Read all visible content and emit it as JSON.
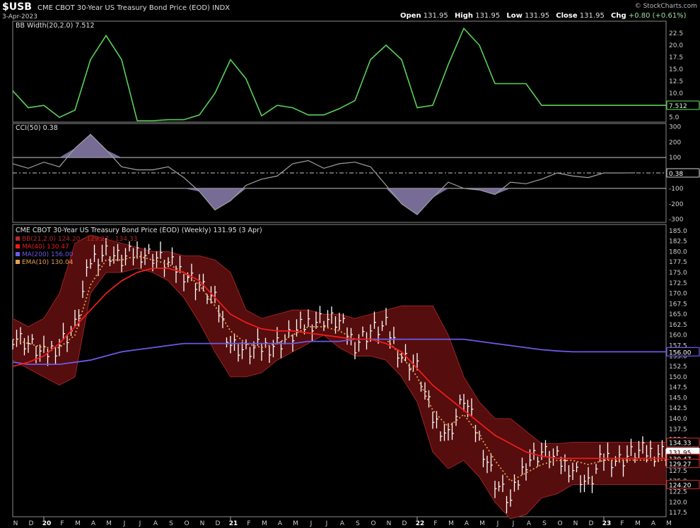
{
  "header": {
    "symbol": "$USB",
    "name": "CME CBOT 30-Year US Treasury Bond Price (EOD)",
    "exchange": "INDX",
    "date": "3-Apr-2023",
    "open_label": "Open",
    "open": "131.95",
    "high_label": "High",
    "high": "131.95",
    "low_label": "Low",
    "low": "131.95",
    "close_label": "Close",
    "close": "131.95",
    "chg_label": "Chg",
    "chg": "+0.80 (+0.61%)",
    "source": "© StockCharts.com"
  },
  "colors": {
    "background": "#000000",
    "bbwidth_line": "#58d058",
    "cci_line": "#a0a0a0",
    "cci_fill": "#8c7fb0",
    "price_bars": "#ffffff",
    "bb_fill": "#5a0e0e",
    "bb_lines": "#b82828",
    "ma40": "#ee1c1c",
    "ma200": "#6a5ae8",
    "ema10": "#e8a050"
  },
  "chart_data": [
    {
      "type": "line",
      "panel": "indicator",
      "title": "BB Width(20,2.0) 7.512",
      "ylim": [
        4,
        25
      ],
      "yticks": [
        5.0,
        7.5,
        10.0,
        12.5,
        15.0,
        17.5,
        20.0,
        22.5
      ],
      "ytick_labels": [
        "5.0",
        "7.5",
        "10.0",
        "12.5",
        "15.0",
        "17.5",
        "20.0",
        "22.5"
      ],
      "last_value_label": "7.512",
      "x_points": [
        0,
        4,
        8,
        12,
        16,
        20,
        24,
        28,
        32,
        36,
        40,
        44,
        48,
        52,
        56,
        60,
        64,
        68,
        72,
        76,
        80,
        84,
        88,
        92,
        96,
        100,
        104,
        108,
        112,
        116,
        120,
        124,
        128,
        132,
        136,
        140,
        144,
        148,
        152,
        156,
        160,
        164,
        168
      ],
      "values": [
        10.5,
        7.0,
        7.5,
        5.0,
        6.5,
        17,
        22,
        17,
        4.3,
        4.3,
        4.5,
        4.5,
        5.5,
        10,
        17,
        13,
        5.3,
        7.5,
        7,
        5.5,
        5.5,
        6.8,
        8.5,
        17,
        20,
        17,
        7,
        7.5,
        16,
        23.5,
        20,
        12,
        12,
        12,
        7.5,
        7.5,
        7.5,
        7.5,
        7.5,
        7.5,
        7.5,
        7.5,
        7.5
      ]
    },
    {
      "type": "area",
      "panel": "indicator",
      "title": "CCI(50) 0.38",
      "ylim": [
        -320,
        320
      ],
      "yticks": [
        -300,
        -200,
        -100,
        100,
        200,
        300
      ],
      "ytick_labels": [
        "300",
        "200",
        "100",
        "-100",
        "-200",
        "-300"
      ],
      "reference_lines": [
        100,
        0,
        -100
      ],
      "last_value_label": "0.38",
      "x_points": [
        0,
        4,
        8,
        12,
        16,
        20,
        24,
        28,
        32,
        36,
        40,
        44,
        48,
        52,
        56,
        60,
        64,
        68,
        72,
        76,
        80,
        84,
        88,
        92,
        96,
        100,
        104,
        108,
        112,
        116,
        120,
        124,
        128,
        132,
        136,
        140,
        144,
        148,
        152,
        156,
        160
      ],
      "values": [
        60,
        30,
        70,
        40,
        160,
        250,
        150,
        40,
        20,
        20,
        40,
        -30,
        -120,
        -240,
        -180,
        -80,
        -40,
        -20,
        60,
        80,
        30,
        60,
        70,
        40,
        -80,
        -200,
        -270,
        -160,
        -60,
        -100,
        -110,
        -140,
        -60,
        -70,
        -40,
        0,
        -20,
        -30,
        0,
        0,
        0.38
      ]
    },
    {
      "type": "line",
      "panel": "price",
      "title": "CME CBOT 30-Year US Treasury Bond Price (EOD) (Weekly) 131.95 (3 Apr)",
      "legend": [
        {
          "name": "BB(21,2.0) 124.20 - 129.27 - 134.33",
          "swatch": "bb"
        },
        {
          "name": "MA(40) 130.47",
          "swatch": "ma40"
        },
        {
          "name": "MA(200) 156.00",
          "swatch": "ma200"
        },
        {
          "name": "EMA(10) 130.04",
          "swatch": "ema10"
        }
      ],
      "legend_position": "top-left",
      "ylim": [
        116.5,
        186.5
      ],
      "yticks": [
        117.5,
        120,
        122.5,
        125,
        127.5,
        130,
        132.5,
        135,
        137.5,
        140,
        142.5,
        145,
        147.5,
        150,
        152.5,
        155,
        157.5,
        160,
        162.5,
        165,
        167.5,
        170,
        172.5,
        175,
        177.5,
        180,
        182.5,
        185
      ],
      "ytick_labels": [
        "117.5",
        "120.0",
        "122.5",
        "125.0",
        "127.5",
        "130.0",
        "132.5",
        "135.0",
        "137.5",
        "140.0",
        "142.5",
        "145.0",
        "147.5",
        "150.0",
        "152.5",
        "155.0",
        "157.5",
        "160.0",
        "162.5",
        "165.0",
        "167.5",
        "170.0",
        "172.5",
        "175.0",
        "177.5",
        "180.0",
        "182.5",
        "185.0"
      ],
      "value_tags": [
        {
          "label": "134.33",
          "value": 134.33,
          "color": "#b82828"
        },
        {
          "label": "131.95",
          "value": 131.95,
          "color": "#ffffff"
        },
        {
          "label": "130.47",
          "value": 130.47,
          "color": "#ee1c1c"
        },
        {
          "label": "129.27",
          "value": 129.27,
          "color": "#b82828"
        },
        {
          "label": "124.20",
          "value": 124.2,
          "color": "#b82828"
        },
        {
          "label": "156.00",
          "value": 156.0,
          "color": "#6a5ae8"
        }
      ],
      "x_points": [
        0,
        4,
        8,
        12,
        16,
        20,
        24,
        28,
        32,
        36,
        40,
        44,
        48,
        52,
        56,
        60,
        64,
        68,
        72,
        76,
        80,
        84,
        88,
        92,
        96,
        100,
        104,
        108,
        112,
        116,
        120,
        124,
        128,
        132,
        136,
        140,
        144,
        148,
        152,
        156,
        160,
        164,
        168
      ],
      "series": [
        {
          "name": "Close",
          "values": [
            160,
            158,
            155,
            158,
            162,
            178,
            180,
            178,
            180,
            179,
            177,
            175,
            172,
            168,
            158,
            156,
            157,
            158,
            160,
            163,
            164,
            163,
            158,
            161,
            162,
            155,
            152,
            140,
            136,
            145,
            135,
            125,
            120,
            130,
            132,
            130,
            128,
            124,
            131,
            130,
            131.95,
            131.95,
            131.95
          ]
        },
        {
          "name": "BB upper",
          "values": [
            164,
            162,
            164,
            170,
            182,
            184,
            183,
            182,
            181,
            180,
            180,
            179,
            179,
            178,
            175,
            166,
            164,
            165,
            166,
            166,
            165,
            165,
            164,
            165,
            166,
            167,
            167,
            167,
            160,
            150,
            144,
            140,
            140,
            137,
            134,
            134,
            134.33,
            134.33,
            134.33,
            134.33,
            134.33,
            134.33,
            134.33
          ]
        },
        {
          "name": "BB lower",
          "values": [
            154,
            152,
            150,
            148,
            150,
            170,
            175,
            175,
            176,
            175,
            173,
            169,
            163,
            156,
            150,
            150,
            151,
            154,
            156,
            158,
            160,
            157,
            155,
            155,
            154,
            150,
            144,
            132,
            128,
            130,
            126,
            120,
            116,
            117,
            121,
            122,
            124.2,
            124.2,
            124.2,
            124.2,
            124.2,
            124.2,
            124.2
          ]
        },
        {
          "name": "MA(40)",
          "values": [
            152.5,
            153.5,
            155,
            158,
            162,
            166,
            170,
            173,
            175,
            176,
            176,
            175,
            173,
            169,
            165,
            163,
            161.5,
            161,
            161,
            160.5,
            160,
            159.5,
            159,
            159,
            158,
            156,
            152,
            148,
            145,
            142,
            139,
            136,
            134,
            132,
            131,
            130.5,
            130.47,
            130.47,
            130.47,
            130.47,
            130.47,
            130.47,
            130.47
          ]
        },
        {
          "name": "MA(200)",
          "values": [
            153.5,
            153,
            153,
            153,
            153.5,
            154,
            155,
            156,
            156.5,
            157,
            157.5,
            158,
            158,
            158,
            158,
            158,
            158,
            158,
            158,
            158.5,
            158.5,
            158.5,
            159,
            159,
            159,
            159,
            159,
            159,
            159,
            159,
            158.5,
            158,
            157.5,
            157,
            156.5,
            156.2,
            156,
            156,
            156,
            156,
            156,
            156,
            156
          ]
        },
        {
          "name": "EMA(10)",
          "values": [
            159,
            158,
            157,
            157,
            160,
            172,
            178,
            178,
            179,
            178,
            177,
            175,
            172,
            167,
            161,
            158,
            157,
            158,
            160,
            162,
            162,
            161,
            159,
            159,
            159,
            155,
            150,
            142,
            138,
            141,
            136,
            130,
            125,
            127,
            129,
            130,
            130,
            129,
            130,
            130.04,
            130.04,
            130.04,
            130.04
          ]
        }
      ]
    }
  ],
  "x_axis": {
    "labels": [
      "N",
      "D",
      "20",
      "F",
      "M",
      "A",
      "M",
      "J",
      "J",
      "A",
      "S",
      "O",
      "N",
      "D",
      "21",
      "F",
      "M",
      "A",
      "M",
      "J",
      "J",
      "A",
      "S",
      "O",
      "N",
      "D",
      "22",
      "F",
      "M",
      "A",
      "M",
      "J",
      "J",
      "A",
      "S",
      "O",
      "N",
      "D",
      "23",
      "F",
      "M",
      "A",
      "M"
    ],
    "bold_labels": [
      "20",
      "21",
      "22",
      "23"
    ]
  }
}
